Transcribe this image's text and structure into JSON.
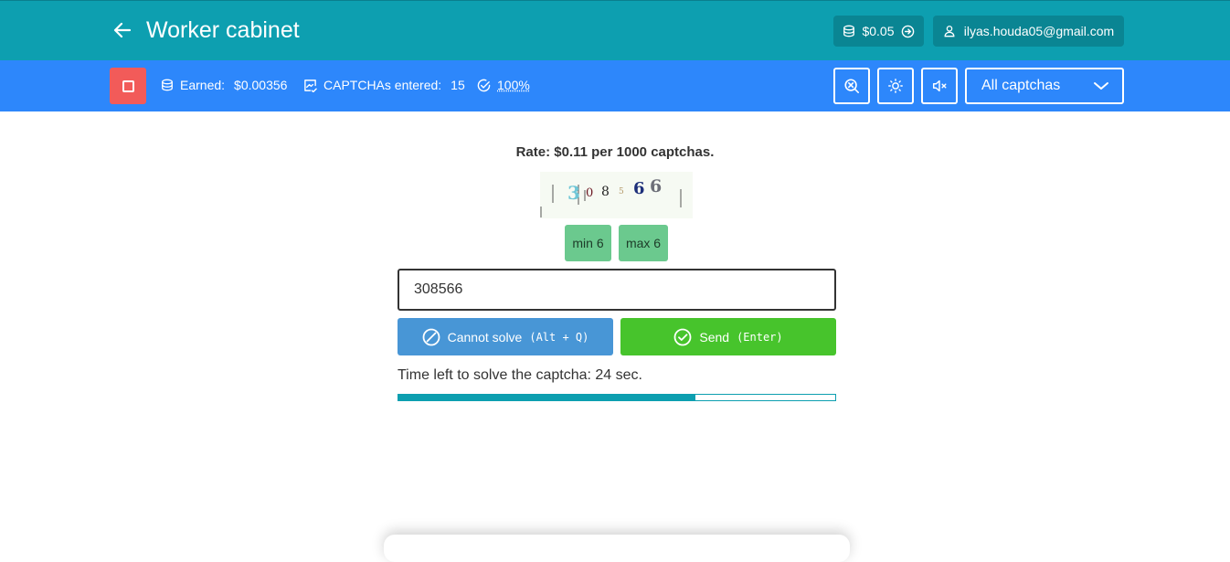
{
  "header": {
    "title": "Worker cabinet",
    "balance": "$0.05",
    "user_email": "ilyas.houda05@gmail.com"
  },
  "stats": {
    "earned_label": "Earned:",
    "earned_value": "$0.00356",
    "entered_label": "CAPTCHAs entered:",
    "entered_value": "15",
    "accuracy": "100%",
    "captcha_filter": "All captchas"
  },
  "main": {
    "rate": "Rate: $0.11 per 1000 captchas.",
    "captcha_chars": [
      "3",
      "0",
      "8",
      "5",
      "6",
      "6"
    ],
    "min_label": "min 6",
    "max_label": "max 6",
    "answer_value": "308566",
    "cannot_solve_label": "Cannot solve",
    "cannot_solve_shortcut": "(Alt + Q)",
    "send_label": "Send",
    "send_shortcut": "(Enter)",
    "timer_text": "Time left to solve the captcha: 24 sec.",
    "time_progress": 0.68
  },
  "colors": {
    "header": "#0d9fb0",
    "statbar": "#2d87fb",
    "stop": "#f25b59",
    "cannot": "#4896d6",
    "send": "#47c42c",
    "chip": "#6bc98e"
  },
  "icons": [
    "back-arrow-icon",
    "coins-icon",
    "arrow-circle-right-icon",
    "user-icon",
    "stop-icon",
    "captcha-image-icon",
    "check-circle-icon",
    "zoom-icon",
    "brightness-icon",
    "mute-icon",
    "chevron-down-icon",
    "ban-icon"
  ]
}
